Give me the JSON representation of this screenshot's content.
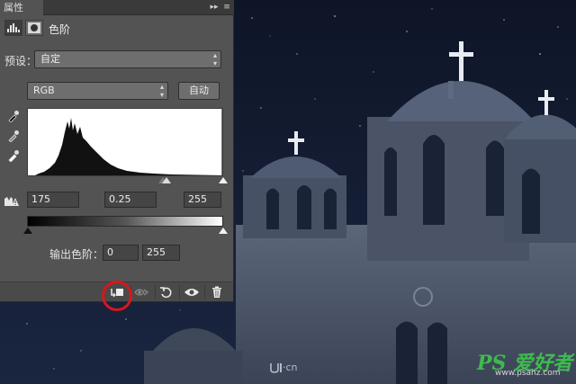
{
  "panel": {
    "tab_title": "属性",
    "window_controls": {
      "collapse": "▸▸",
      "menu": "≡"
    },
    "adjustment_title": "色阶",
    "preset_label": "预设：",
    "preset_value": "自定",
    "channel_value": "RGB",
    "auto_button": "自动",
    "input_levels": {
      "black": "175",
      "gamma": "0.25",
      "white": "255"
    },
    "output_label": "输出色阶：",
    "output_levels": {
      "black": "0",
      "white": "255"
    }
  },
  "footer": {
    "icons": [
      "clip-to-layer-icon",
      "view-previous-state-icon",
      "reset-icon",
      "visibility-eye-icon",
      "trash-icon"
    ]
  },
  "highlight": {
    "color": "#d8161b",
    "target": "clip-to-layer-icon"
  },
  "watermarks": {
    "ui_cn": "·cn",
    "ps_logo": "PS 爱好者",
    "url": "www.psahz.com"
  },
  "colors": {
    "panel_bg": "#535353",
    "sky": "#121a2c",
    "highlight": "#d8161b"
  }
}
